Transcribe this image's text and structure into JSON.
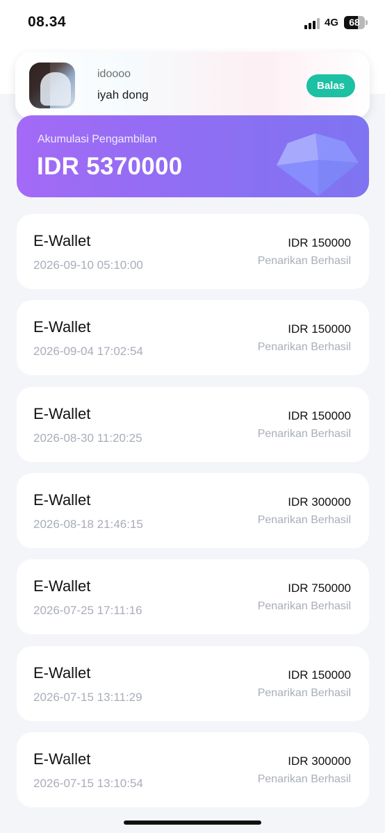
{
  "status_bar": {
    "time": "08.34",
    "network": "4G",
    "battery": "68",
    "battery_level": 0.68
  },
  "notification": {
    "sender": "idoooo",
    "message": "iyah dong",
    "reply_label": "Balas",
    "reply_color": "#1cc0a3"
  },
  "summary": {
    "label": "Akumulasi Pengambilan",
    "amount": "IDR 5370000",
    "gradient_start": "#a36af6",
    "gradient_end": "#7e74f1"
  },
  "transactions": [
    {
      "method": "E-Wallet",
      "date": "2026-09-10 05:10:00",
      "amount": "IDR 150000",
      "status": "Penarikan Berhasil"
    },
    {
      "method": "E-Wallet",
      "date": "2026-09-04 17:02:54",
      "amount": "IDR 150000",
      "status": "Penarikan Berhasil"
    },
    {
      "method": "E-Wallet",
      "date": "2026-08-30 11:20:25",
      "amount": "IDR 150000",
      "status": "Penarikan Berhasil"
    },
    {
      "method": "E-Wallet",
      "date": "2026-08-18 21:46:15",
      "amount": "IDR 300000",
      "status": "Penarikan Berhasil"
    },
    {
      "method": "E-Wallet",
      "date": "2026-07-25 17:11:16",
      "amount": "IDR 750000",
      "status": "Penarikan Berhasil"
    },
    {
      "method": "E-Wallet",
      "date": "2026-07-15 13:11:29",
      "amount": "IDR 150000",
      "status": "Penarikan Berhasil"
    },
    {
      "method": "E-Wallet",
      "date": "2026-07-15 13:10:54",
      "amount": "IDR 300000",
      "status": "Penarikan Berhasil"
    }
  ]
}
